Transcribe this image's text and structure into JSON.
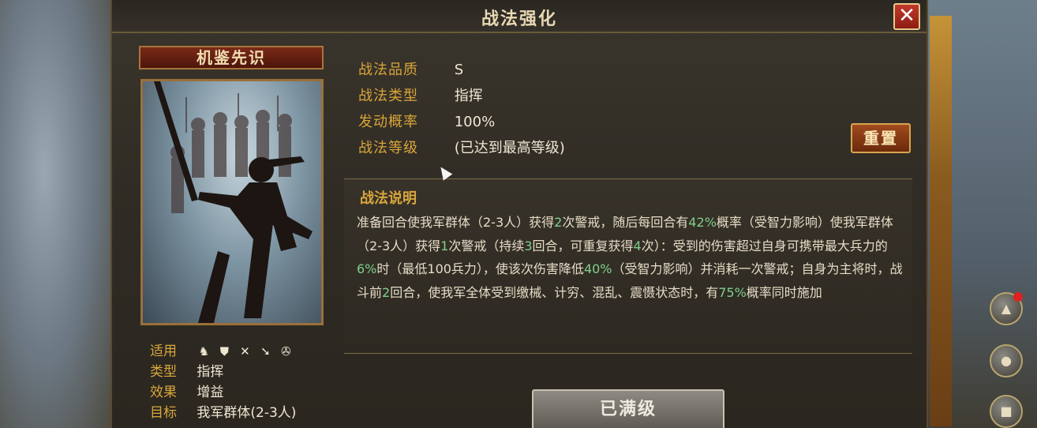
{
  "dialog": {
    "title": "战法强化",
    "close_label": "✕"
  },
  "card": {
    "name": "机鉴先识",
    "attributes": [
      {
        "key": "适用",
        "value": ""
      },
      {
        "key": "类型",
        "value": "指挥"
      },
      {
        "key": "效果",
        "value": "增益"
      },
      {
        "key": "目标",
        "value": "我军群体(2-3人)"
      }
    ],
    "unit_icons": [
      "cavalry-icon",
      "shield-icon",
      "archer-icon",
      "spear-icon",
      "siege-icon"
    ]
  },
  "info": {
    "quality_label": "战法品质",
    "quality_value": "S",
    "type_label": "战法类型",
    "type_value": "指挥",
    "chance_label": "发动概率",
    "chance_value": "100%",
    "level_label": "战法等级",
    "level_value": "(已达到最高等级)"
  },
  "reset_label": "重置",
  "description": {
    "title": "战法说明",
    "segments": [
      {
        "t": "准备回合使我军群体（2-3人）获得",
        "h": false
      },
      {
        "t": "2",
        "h": true
      },
      {
        "t": "次警戒，随后每回合有",
        "h": false
      },
      {
        "t": "42%",
        "h": true
      },
      {
        "t": "概率（受智力影响）使我军群体（2-3人）获得",
        "h": false
      },
      {
        "t": "1",
        "h": true
      },
      {
        "t": "次警戒（持续",
        "h": false
      },
      {
        "t": "3",
        "h": true
      },
      {
        "t": "回合，可重复获得",
        "h": false
      },
      {
        "t": "4",
        "h": true
      },
      {
        "t": "次）：受到的伤害超过自身可携带最大兵力的",
        "h": false
      },
      {
        "t": "6%",
        "h": true
      },
      {
        "t": "时（最低100兵力），使该次伤害降低",
        "h": false
      },
      {
        "t": "40%",
        "h": true
      },
      {
        "t": "（受智力影响）并消耗一次警戒；自身为主将时，战斗前",
        "h": false
      },
      {
        "t": "2",
        "h": true
      },
      {
        "t": "回合，使我军全体受到缴械、计穷、混乱、震慑状态时，有",
        "h": false
      },
      {
        "t": "75%",
        "h": true
      },
      {
        "t": "概率同时施加",
        "h": false
      }
    ]
  },
  "maxed_label": "已满级",
  "colors": {
    "accent_gold": "#d9a63a",
    "highlight_green": "#7fd08a",
    "close_red": "#c0392b"
  }
}
